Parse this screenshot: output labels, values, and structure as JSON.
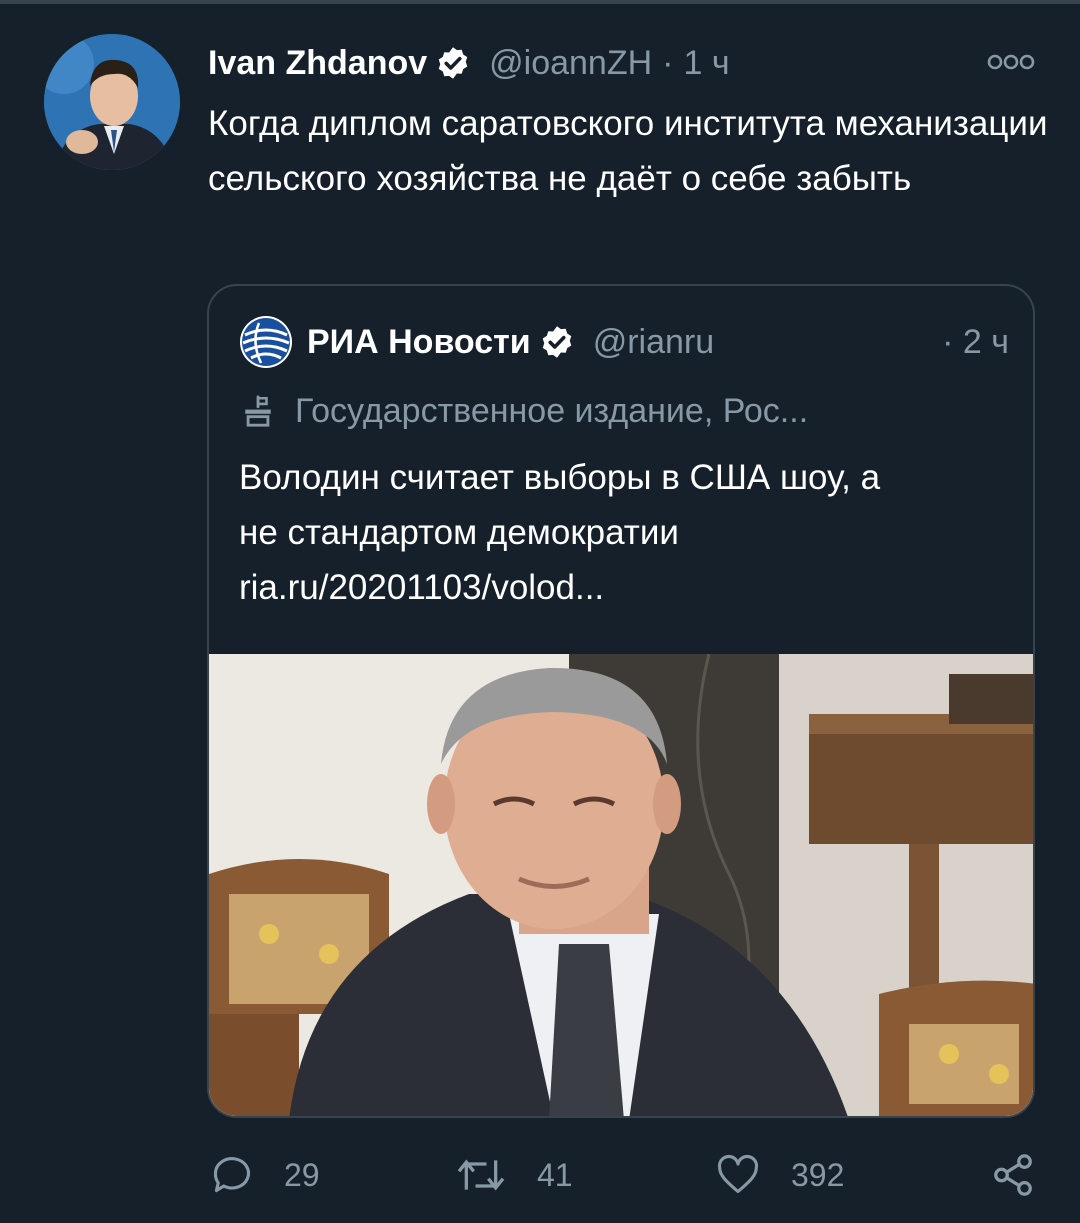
{
  "tweet": {
    "author_name": "Ivan Zhdanov",
    "handle": "@ioannZH",
    "separator": "·",
    "time": "1 ч",
    "text": "Когда диплом саратовского института механизации сельского хозяйства не даёт о себе забыть"
  },
  "quote": {
    "author_name": "РИА Новости",
    "handle": "@rianru",
    "time": "· 2 ч",
    "label": "Государственное издание, Рос...",
    "text_lines": [
      "Володин считает выборы в США шоу, а",
      "не стандартом демократии",
      "ria.ru/20201103/volod..."
    ]
  },
  "actions": {
    "reply_count": "29",
    "retweet_count": "41",
    "like_count": "392"
  },
  "icons": {
    "verified": "verified-badge-icon",
    "more": "more-options-icon",
    "label": "state-media-icon",
    "reply": "reply-icon",
    "retweet": "retweet-icon",
    "like": "heart-icon",
    "share": "share-icon"
  },
  "colors": {
    "background": "#15202b",
    "border": "#38444d",
    "secondary_text": "#8899a6",
    "primary_text": "#ffffff"
  }
}
